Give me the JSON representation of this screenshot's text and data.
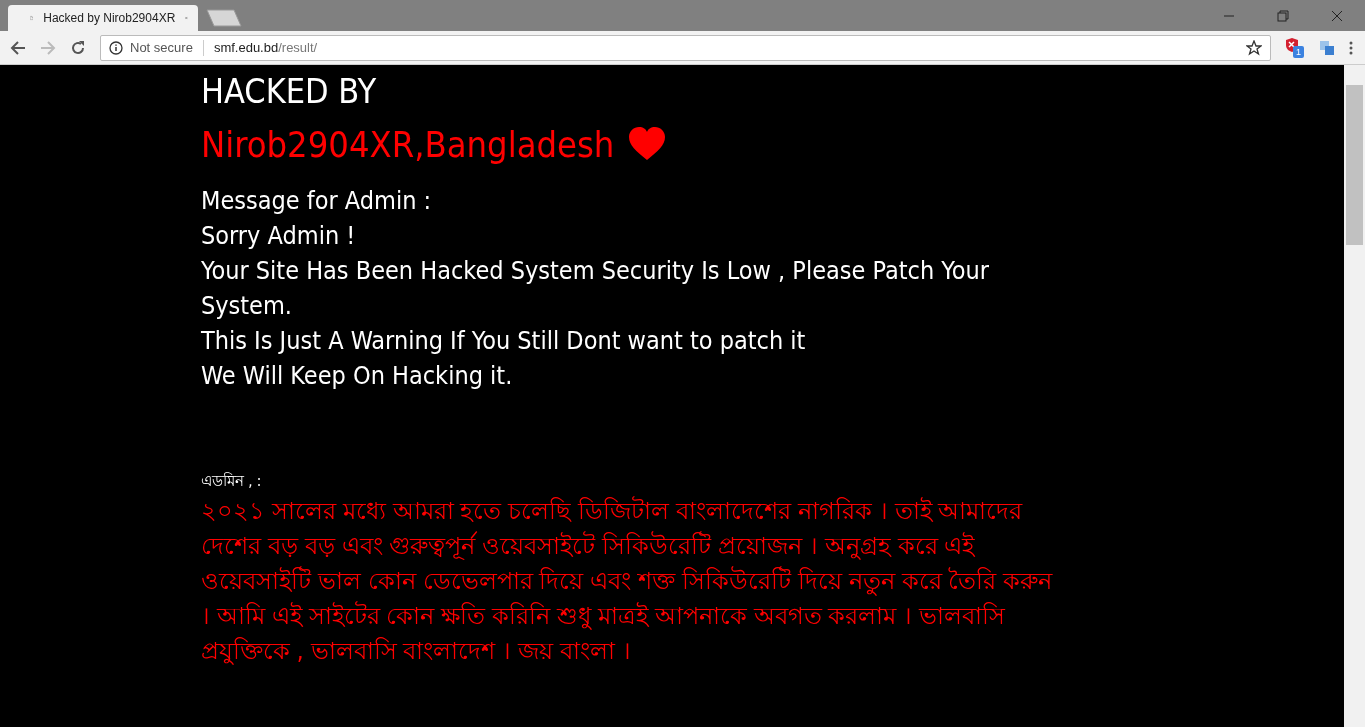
{
  "browser": {
    "tabs": [
      {
        "title": "Hacked by Nirob2904XR",
        "selected": true
      }
    ],
    "security_label": "Not secure",
    "url_host": "smf.edu.bd",
    "url_path": "/result/",
    "extension_badge": "1"
  },
  "page": {
    "heading": "HACKED BY",
    "hacker": "Nirob2904XR,Bangladesh",
    "message_lines": [
      "Message for Admin :",
      "Sorry Admin !",
      "Your Site Has Been Hacked System Security Is Low , Please Patch Your System.",
      "This Is Just A Warning If You Still Dont want to patch it",
      "We Will Keep On Hacking it."
    ],
    "bangla_label": "এডমিন , :",
    "bangla_message": "২০২১ সালের মধ্যে আমরা হতে চলেছি ডিজিটাল বাংলাদেশের নাগরিক । তাই আমাদের দেশের বড় বড় এবং গুরুত্বপূর্ন ওয়েবসাইটে সিকিউরেটি প্রয়োজন । অনুগ্রহ করে এই ওয়েবসাইটি ভাল কোন ডেভেলপার দিয়ে এবং শক্ত সিকিউরেটি দিয়ে নতুন করে তৈরি করুন । আমি এই সাইটের কোন ক্ষতি করিনি শুধু মাত্রই আপনাকে অবগত করলাম । ভালবাসি প্রযুক্তিকে , ভালবাসি বাংলাদেশ । জয় বাংলা ।"
  }
}
